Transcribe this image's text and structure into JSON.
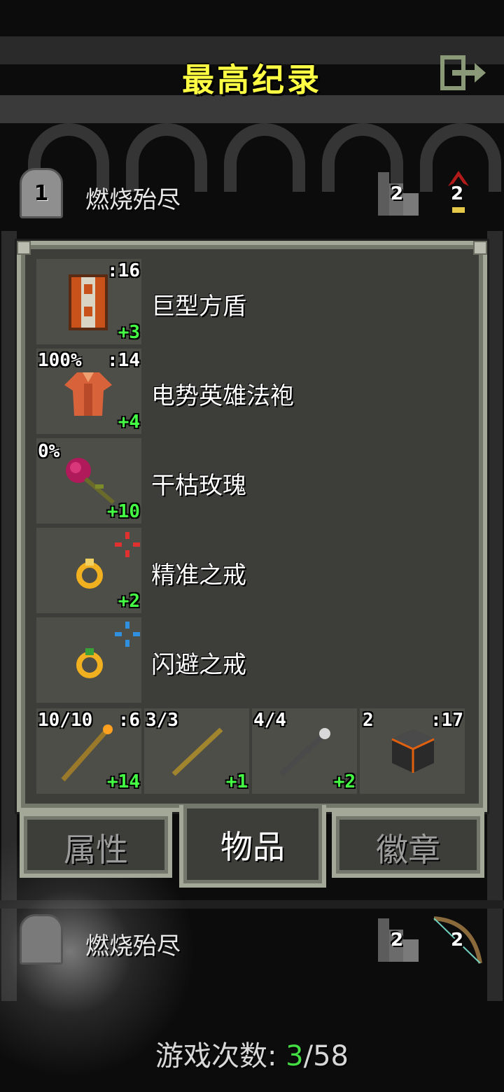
{
  "screen": {
    "title": "最高纪录"
  },
  "records": [
    {
      "rank": "1",
      "name": "燃烧殆尽",
      "depth": "2",
      "level": "2"
    },
    {
      "rank": "",
      "name": "燃烧殆尽",
      "depth": "2",
      "level": "2"
    }
  ],
  "equipped": [
    {
      "name": "巨型方盾",
      "top_right": ":16",
      "top_left": "",
      "bottom": "+3",
      "icon": "tower-shield-icon"
    },
    {
      "name": "电势英雄法袍",
      "top_right": ":14",
      "top_left": "100%",
      "bottom": "+4",
      "icon": "robe-icon"
    },
    {
      "name": "干枯玫瑰",
      "top_right": "",
      "top_left": "0%",
      "bottom": "+10",
      "icon": "rose-icon"
    },
    {
      "name": "精准之戒",
      "top_right": "",
      "top_left": "",
      "bottom": "+2",
      "icon": "ring-icon"
    },
    {
      "name": "闪避之戒",
      "top_right": "",
      "top_left": "",
      "bottom": "",
      "icon": "ring-icon"
    }
  ],
  "quickslots": [
    {
      "top_left": "10/10",
      "top_right": ":6",
      "bottom": "+14",
      "icon": "wand-icon"
    },
    {
      "top_left": "3/3",
      "top_right": "",
      "bottom": "+1",
      "icon": "wand-icon"
    },
    {
      "top_left": "4/4",
      "top_right": "",
      "bottom": "+2",
      "icon": "wand-icon"
    },
    {
      "top_left": "2",
      "top_right": ":17",
      "bottom": "",
      "icon": "stone-cube-icon"
    }
  ],
  "tabs": {
    "stats": "属性",
    "items": "物品",
    "badges": "徽章",
    "active": "items"
  },
  "footer": {
    "label": "游戏次数:",
    "current": "3",
    "separator": "/",
    "total": "58"
  },
  "colors": {
    "title": "#ffff44",
    "upgrade": "#44ff44",
    "panel": "#3d3e39",
    "border": "#a4a898"
  }
}
